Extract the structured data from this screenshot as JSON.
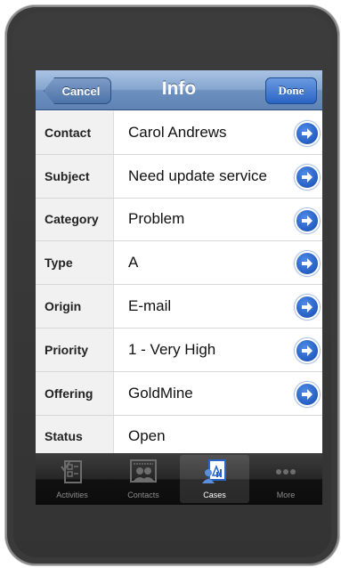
{
  "navbar": {
    "title": "Info",
    "back_label": "Cancel",
    "done_label": "Done"
  },
  "fields": [
    {
      "label": "Contact",
      "value": "Carol Andrews",
      "has_disclosure": true
    },
    {
      "label": "Subject",
      "value": "Need update service",
      "has_disclosure": true
    },
    {
      "label": "Category",
      "value": "Problem",
      "has_disclosure": true
    },
    {
      "label": "Type",
      "value": "A",
      "has_disclosure": true
    },
    {
      "label": "Origin",
      "value": "E-mail",
      "has_disclosure": true
    },
    {
      "label": "Priority",
      "value": "1 - Very High",
      "has_disclosure": true
    },
    {
      "label": "Offering",
      "value": "GoldMine",
      "has_disclosure": true
    },
    {
      "label": "Status",
      "value": "Open",
      "has_disclosure": false
    }
  ],
  "tabbar": {
    "tabs": [
      {
        "label": "Activities",
        "icon": "checklist-icon",
        "selected": false
      },
      {
        "label": "Contacts",
        "icon": "contacts-icon",
        "selected": false
      },
      {
        "label": "Cases",
        "icon": "cases-icon",
        "selected": true
      },
      {
        "label": "More",
        "icon": "more-dots-icon",
        "selected": false
      }
    ]
  },
  "colors": {
    "navbar": "#6d90bf",
    "disclosure": "#2a64c7",
    "tabbar": "#111111",
    "device": "#3a3a3a"
  }
}
